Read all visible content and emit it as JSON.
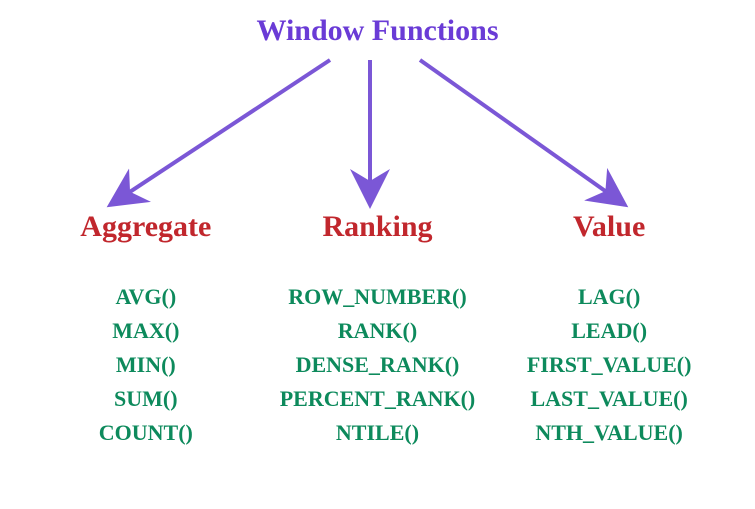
{
  "title": "Window Functions",
  "categories": [
    {
      "label": "Aggregate",
      "functions": [
        "AVG()",
        "MAX()",
        "MIN()",
        "SUM()",
        "COUNT()"
      ]
    },
    {
      "label": "Ranking",
      "functions": [
        "ROW_NUMBER()",
        "RANK()",
        "DENSE_RANK()",
        "PERCENT_RANK()",
        "NTILE()"
      ]
    },
    {
      "label": "Value",
      "functions": [
        "LAG()",
        "LEAD()",
        "FIRST_VALUE()",
        "LAST_VALUE()",
        "NTH_VALUE()"
      ]
    }
  ],
  "chart_data": {
    "type": "table",
    "title": "Window Functions",
    "root": "Window Functions",
    "children": [
      {
        "name": "Aggregate",
        "items": [
          "AVG()",
          "MAX()",
          "MIN()",
          "SUM()",
          "COUNT()"
        ]
      },
      {
        "name": "Ranking",
        "items": [
          "ROW_NUMBER()",
          "RANK()",
          "DENSE_RANK()",
          "PERCENT_RANK()",
          "NTILE()"
        ]
      },
      {
        "name": "Value",
        "items": [
          "LAG()",
          "LEAD()",
          "FIRST_VALUE()",
          "LAST_VALUE()",
          "NTH_VALUE()"
        ]
      }
    ]
  },
  "colors": {
    "title": "#6a3bd6",
    "arrow": "#7b57d6",
    "category": "#c1272d",
    "function": "#0d8a5c"
  }
}
